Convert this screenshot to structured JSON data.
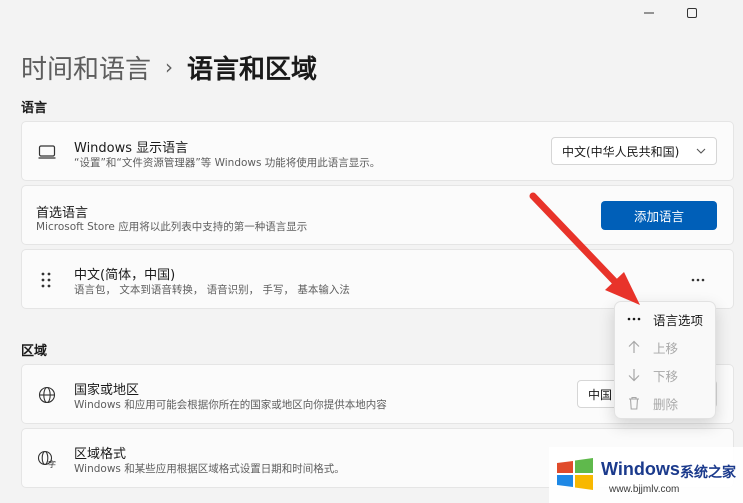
{
  "window": {
    "minimize_icon": "minimize-icon",
    "maximize_icon": "maximize-icon"
  },
  "breadcrumb": {
    "parent": "时间和语言",
    "separator": "›",
    "current": "语言和区域"
  },
  "language_section": {
    "label": "语言",
    "display_language": {
      "icon": "monitor-icon",
      "title": "Windows 显示语言",
      "description": "“设置”和“文件资源管理器”等 Windows 功能将使用此语言显示。",
      "selected": "中文(中华人民共和国)"
    },
    "preferred": {
      "title": "首选语言",
      "description": "Microsoft Store 应用将以此列表中支持的第一种语言显示",
      "add_button": "添加语言"
    },
    "language_item": {
      "icon": "drag-handle-icon",
      "title": "中文(简体，中国)",
      "description": "语言包， 文本到语音转换， 语音识别， 手写， 基本输入法",
      "more_icon": "more-icon"
    }
  },
  "context_menu": {
    "items": [
      {
        "icon": "more-icon",
        "label": "语言选项",
        "enabled": true
      },
      {
        "icon": "arrow-up-icon",
        "label": "上移",
        "enabled": false
      },
      {
        "icon": "arrow-down-icon",
        "label": "下移",
        "enabled": false
      },
      {
        "icon": "trash-icon",
        "label": "删除",
        "enabled": false
      }
    ]
  },
  "region_section": {
    "label": "区域",
    "country": {
      "icon": "globe-icon",
      "title": "国家或地区",
      "description": "Windows 和应用可能会根据你所在的国家或地区向你提供本地内容",
      "selected": "中国"
    },
    "format": {
      "icon": "region-format-icon",
      "title": "区域格式",
      "description": "Windows 和某些应用根据区域格式设置日期和时间格式。"
    }
  },
  "watermark": {
    "brand": "Windows",
    "site": "系统之家",
    "url": "www.bjjmlv.com"
  },
  "colors": {
    "accent": "#005fb8",
    "arrow": "#e8332a"
  }
}
